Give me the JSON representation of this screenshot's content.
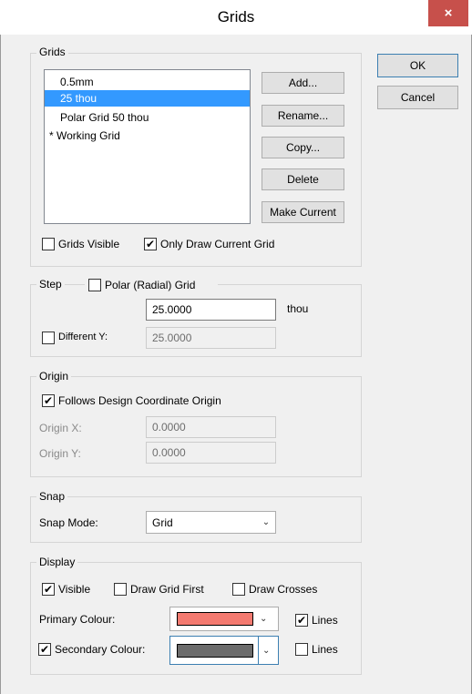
{
  "window": {
    "title": "Grids",
    "close_icon": "×"
  },
  "buttons": {
    "ok": "OK",
    "cancel": "Cancel"
  },
  "grids": {
    "legend": "Grids",
    "items": [
      {
        "label": "0.5mm"
      },
      {
        "label": "25 thou"
      },
      {
        "label": "Polar Grid 50 thou"
      },
      {
        "label": "* Working Grid"
      }
    ],
    "selected_index": 1,
    "add": "Add...",
    "rename": "Rename...",
    "copy": "Copy...",
    "delete": "Delete",
    "make_current": "Make Current",
    "grids_visible": {
      "label": "Grids Visible",
      "checked": false
    },
    "only_draw_current": {
      "label": "Only Draw Current Grid",
      "checked": true
    }
  },
  "step": {
    "legend": "Step",
    "polar": {
      "label": "Polar (Radial) Grid",
      "checked": false
    },
    "value": "25.0000",
    "unit": "thou",
    "different_y": {
      "label": "Different Y:",
      "checked": false
    },
    "y_value": "25.0000"
  },
  "origin": {
    "legend": "Origin",
    "follows": {
      "label": "Follows Design Coordinate Origin",
      "checked": true
    },
    "x_label": "Origin X:",
    "x_value": "0.0000",
    "y_label": "Origin Y:",
    "y_value": "0.0000"
  },
  "snap": {
    "legend": "Snap",
    "mode_label": "Snap Mode:",
    "mode_value": "Grid"
  },
  "display": {
    "legend": "Display",
    "visible": {
      "label": "Visible",
      "checked": true
    },
    "draw_grid_first": {
      "label": "Draw Grid First",
      "checked": false
    },
    "draw_crosses": {
      "label": "Draw Crosses",
      "checked": false
    },
    "primary_label": "Primary Colour:",
    "primary_color": "#f47a70",
    "primary_lines": {
      "label": "Lines",
      "checked": true
    },
    "secondary": {
      "label": "Secondary Colour:",
      "checked": true
    },
    "secondary_color": "#6b6b6b",
    "secondary_lines": {
      "label": "Lines",
      "checked": false
    }
  }
}
